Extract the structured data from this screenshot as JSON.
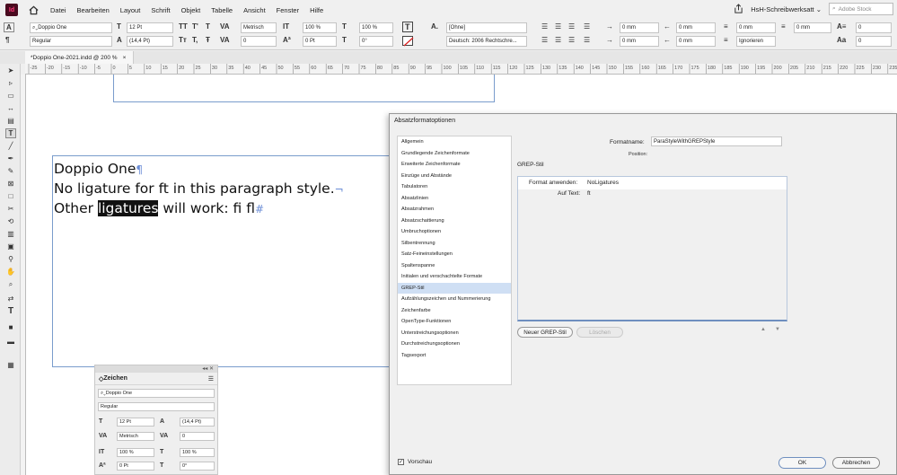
{
  "menubar": {
    "app_logo": "Id",
    "items": [
      "Datei",
      "Bearbeiten",
      "Layout",
      "Schrift",
      "Objekt",
      "Tabelle",
      "Ansicht",
      "Fenster",
      "Hilfe"
    ],
    "workspace": "HsH-Schreibwerksatt",
    "search_placeholder": "Adobe Stock"
  },
  "control": {
    "font_family": "Doppio One",
    "font_style": "Regular",
    "font_size": "12 Pt",
    "leading": "(14,4 Pt)",
    "kerning": "Metrisch",
    "tracking": "0",
    "scale_v": "100 %",
    "scale_h": "100 %",
    "baseline": "0 Pt",
    "skew": "0°",
    "char_style": "[Ohne]",
    "language": "Deutsch: 2006 Rechtschre...",
    "indent_left": "0 mm",
    "indent_first": "0 mm",
    "indent_right": "0 mm",
    "indent_last": "0 mm",
    "space_before": "0 mm",
    "space_after": "0 mm",
    "baseline_grid": "Ignorieren",
    "drop_cap_lines": "0",
    "drop_cap_chars": "0"
  },
  "document_tab": {
    "title": "*Doppio One-2021.indd @ 200 %",
    "close": "×"
  },
  "ruler": {
    "labels": [
      "-25",
      "-20",
      "-15",
      "-10",
      "-5",
      "0",
      "5",
      "10",
      "15",
      "20",
      "25",
      "30",
      "35",
      "40",
      "45",
      "50",
      "55",
      "60",
      "65",
      "70",
      "75",
      "80",
      "85",
      "90",
      "95",
      "100",
      "105",
      "110",
      "115",
      "120",
      "125",
      "130",
      "135",
      "140",
      "145",
      "150",
      "155",
      "160",
      "165",
      "170",
      "175",
      "180",
      "185",
      "190",
      "195",
      "200",
      "205",
      "210",
      "215",
      "220",
      "225",
      "230",
      "235"
    ]
  },
  "story": {
    "line1": "Doppio One",
    "line2": "No ligature for ft in this paragraph style.",
    "line3_before": "Other ",
    "line3_highlight": "ligatures",
    "line3_after": " will work: fi fl",
    "para_mark": "¶",
    "break_mark": "¬",
    "end_mark": "#"
  },
  "zeichen_panel": {
    "title": "Zeichen",
    "font_family": "Doppio One",
    "font_style": "Regular",
    "font_size": "12 Pt",
    "leading": "(14,4 Pt)",
    "kerning": "Metrisch",
    "tracking": "0",
    "scale_v": "100 %",
    "scale_h": "100 %",
    "baseline": "0 Pt",
    "skew": "0°"
  },
  "dialog": {
    "title": "Absatzformatoptionen",
    "categories": [
      "Allgemein",
      "Grundlegende Zeichenformate",
      "Erweiterte Zeichenformate",
      "Einzüge und Abstände",
      "Tabulatoren",
      "Absatzlinien",
      "Absatzrahmen",
      "Absatzschattierung",
      "Umbruchoptionen",
      "Silbentrennung",
      "Satz-Feineinstellungen",
      "Spaltenspanne",
      "Initialen und verschachtelte Formate",
      "GREP-Stil",
      "Aufzählungszeichen und Nummerierung",
      "Zeichenfarbe",
      "OpenType-Funktionen",
      "Unterstreichungsoptionen",
      "Durchstreichungsoptionen",
      "Tagsexport"
    ],
    "selected_index": 13,
    "format_name_label": "Formatname:",
    "format_name_value": "ParaStyleWithGREPStyle",
    "position_label": "Position:",
    "section_title": "GREP-Stil",
    "grep_rule": {
      "apply_label": "Format anwenden:",
      "apply_value": "NoLigatures",
      "to_text_label": "Auf Text:",
      "to_text_value": "ft"
    },
    "new_button": "Neuer GREP-Stil",
    "delete_button": "Löschen",
    "preview_label": "Vorschau",
    "preview_checked": true,
    "ok_button": "OK",
    "cancel_button": "Abbrechen"
  }
}
